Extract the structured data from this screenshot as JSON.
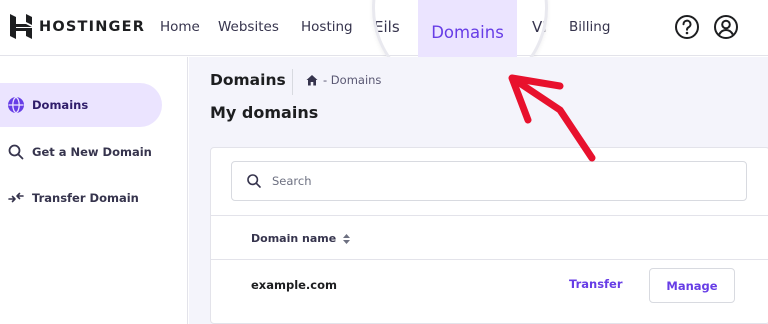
{
  "brand": {
    "name": "HOSTINGER"
  },
  "nav": {
    "home": "Home",
    "websites": "Websites",
    "hosting": "Hosting",
    "emails_partial": "Eils",
    "domains": "Domains",
    "vps_partial": "VI",
    "billing": "Billing"
  },
  "header_icons": [
    "help-icon",
    "account-icon"
  ],
  "sidebar": {
    "items": [
      {
        "label": "Domains",
        "icon": "globe-icon",
        "active": true
      },
      {
        "label": "Get a New Domain",
        "icon": "search-icon",
        "active": false
      },
      {
        "label": "Transfer Domain",
        "icon": "transfer-icon",
        "active": false
      }
    ]
  },
  "main": {
    "page_title": "Domains",
    "breadcrumb": "- Domains",
    "section_title": "My domains",
    "search": {
      "placeholder": "Search",
      "value": ""
    },
    "table": {
      "columns": [
        "Domain name"
      ],
      "rows": [
        {
          "domain": "example.com",
          "transfer_label": "Transfer",
          "manage_label": "Manage"
        }
      ]
    }
  },
  "colors": {
    "accent": "#673de6",
    "active_bg": "#ebe4ff",
    "annotation_arrow": "#e8112d"
  }
}
